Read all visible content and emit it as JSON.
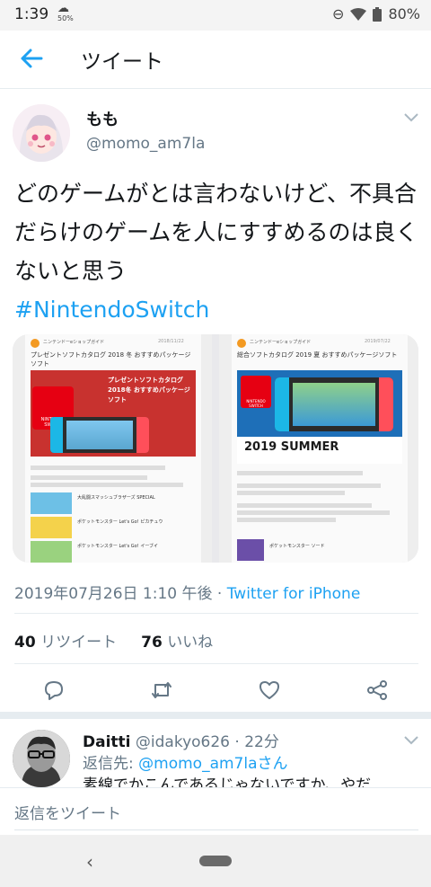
{
  "status_bar": {
    "time": "1:39",
    "data_badge": "50%",
    "battery": "80%"
  },
  "app_bar": {
    "title": "ツイート"
  },
  "tweet": {
    "name": "もも",
    "handle": "@momo_am7la",
    "text": "どのゲームがとは言わないけど、不具合だらけのゲームを人にすすめるのは良くないと思う",
    "hashtag": "#NintendoSwitch",
    "timestamp": "2019年07月26日 1:10 午後",
    "separator": " · ",
    "source": "Twitter for iPhone",
    "retweet_count": "40",
    "retweet_label": "リツイート",
    "like_count": "76",
    "like_label": "いいね"
  },
  "media": {
    "left": {
      "site": "ニンテンドーeショップガイド",
      "date": "2018/11/22",
      "title": "プレゼントソフトカタログ 2018 冬 おすすめパッケージソフト",
      "banner": "プレゼントソフトカタログ 2018冬 おすすめパッケージソフト",
      "logo": "NINTENDO SWITCH",
      "items": [
        "大乱闘スマッシュブラザーズ SPECIAL",
        "ポケットモンスター Let's Go! ピカチュウ",
        "ポケットモンスター Let's Go! イーブイ"
      ]
    },
    "right": {
      "site": "ニンテンドーeショップガイド",
      "date": "2019/07/22",
      "title": "総合ソフトカタログ 2019 夏 おすすめパッケージソフト",
      "banner": "2019 SUMMER",
      "logo": "NINTENDO SWITCH",
      "items": [
        "ポケットモンスター ソード"
      ]
    }
  },
  "reply": {
    "name": "Daitti",
    "handle": "@idakyo626",
    "time": "22分",
    "to_label": "返信先:",
    "to_handle": "@momo_am7laさん",
    "text": "素線でかこんであるじゃないですか、やだ"
  },
  "composer": {
    "placeholder": "返信をツイート"
  },
  "colors": {
    "accent": "#1da1f2",
    "muted": "#657786",
    "text": "#14171a",
    "divider": "#e6ecf0"
  },
  "icons": [
    "back-arrow-icon",
    "chevron-down-icon",
    "reply-icon",
    "retweet-icon",
    "like-icon",
    "share-icon",
    "wifi-icon",
    "battery-icon",
    "dnd-icon"
  ]
}
